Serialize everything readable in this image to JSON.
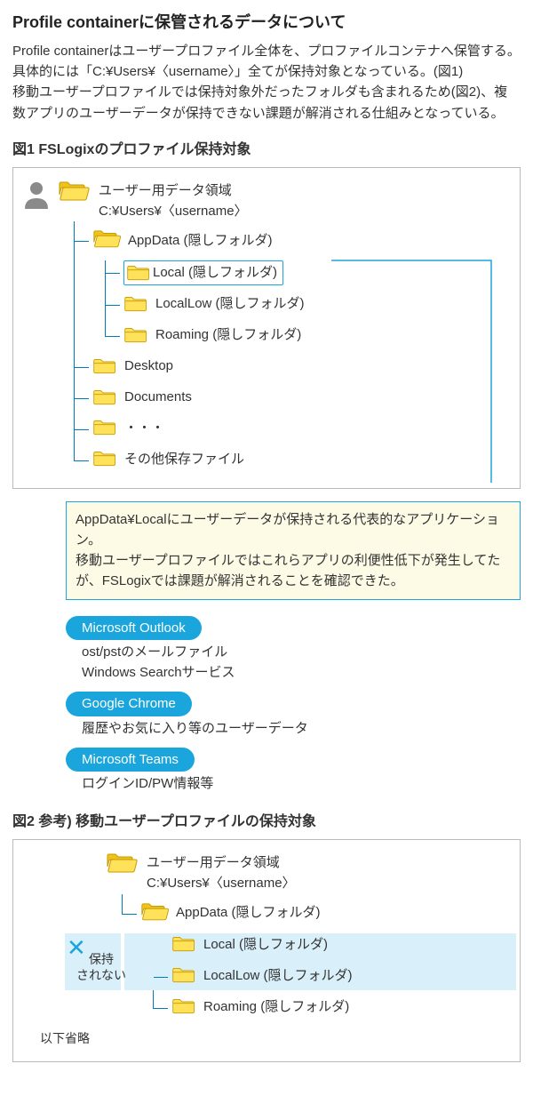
{
  "title": "Profile containerに保管されるデータについて",
  "intro": "Profile containerはユーザープロファイル全体を、プロファイルコンテナへ保管する。具体的には「C:¥Users¥〈username〉」全てが保持対象となっている。(図1)\n移動ユーザープロファイルでは保持対象外だったフォルダも含まれるため(図2)、複数アプリのユーザーデータが保持できない課題が解消される仕組みとなっている。",
  "fig1": {
    "heading": "図1 FSLogixのプロファイル保持対象",
    "root_line1": "ユーザー用データ領域",
    "root_line2": "C:¥Users¥〈username〉",
    "appdata": "AppData (隠しフォルダ)",
    "local": "Local (隠しフォルダ)",
    "locallow": "LocalLow (隠しフォルダ)",
    "roaming": "Roaming (隠しフォルダ)",
    "desktop": "Desktop",
    "documents": "Documents",
    "ellipsis": "・・・",
    "other": "その他保存ファイル"
  },
  "callout": "AppData¥Localにユーザーデータが保持される代表的なアプリケーション。\n移動ユーザープロファイルではこれらアプリの利便性低下が発生してたが、FSLogixでは課題が解消されることを確認できた。",
  "apps": [
    {
      "name": "Microsoft Outlook",
      "desc": "ost/pstのメールファイル\nWindows Searchサービス"
    },
    {
      "name": "Google Chrome",
      "desc": "履歴やお気に入り等のユーザーデータ"
    },
    {
      "name": "Microsoft Teams",
      "desc": "ログインID/PW情報等"
    }
  ],
  "fig2": {
    "heading": "図2 参考) 移動ユーザープロファイルの保持対象",
    "root_line1": "ユーザー用データ領域",
    "root_line2": "C:¥Users¥〈username〉",
    "appdata": "AppData (隠しフォルダ)",
    "local": "Local (隠しフォルダ)",
    "locallow": "LocalLow (隠しフォルダ)",
    "roaming": "Roaming (隠しフォルダ)",
    "not_kept": "保持\nされない",
    "omit": "以下省略"
  }
}
